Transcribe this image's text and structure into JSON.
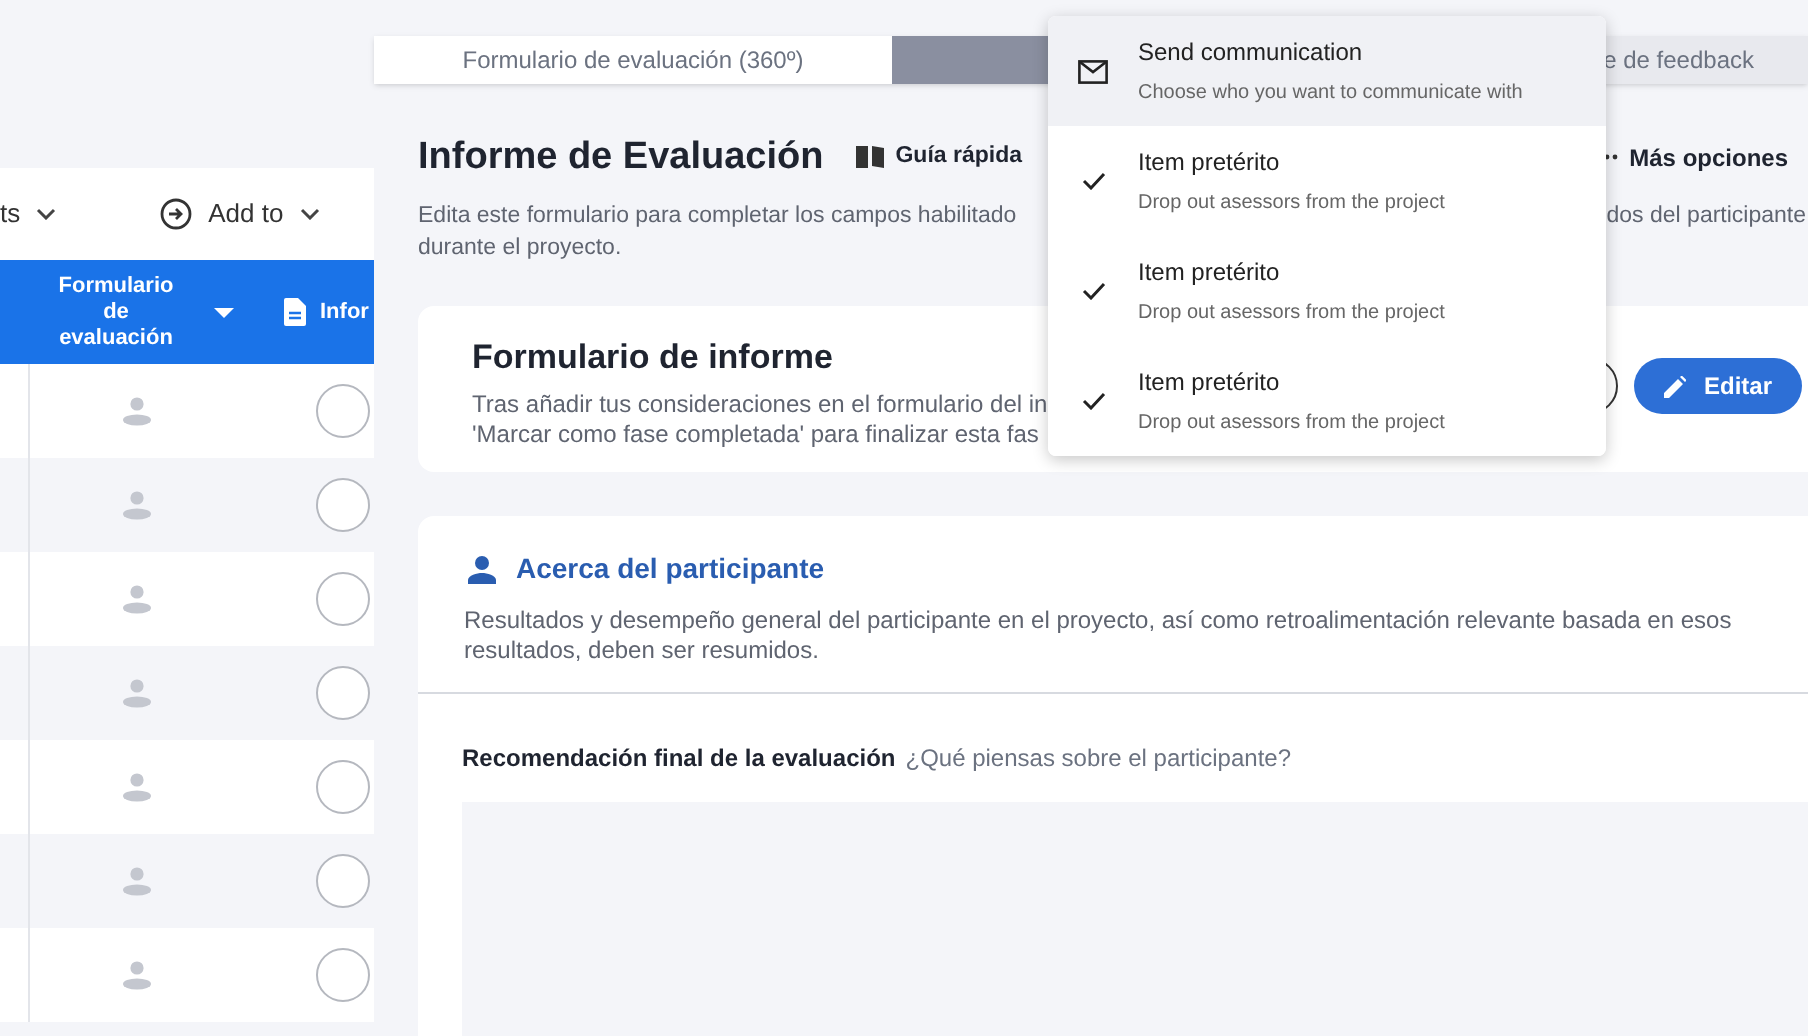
{
  "left_panel": {
    "toolbar": [
      {
        "label": "ts",
        "kind": "dropdown"
      },
      {
        "label": "Add to",
        "kind": "add"
      }
    ],
    "table": {
      "columns": [
        {
          "label": "Formulario de evaluación",
          "kind": "sort"
        },
        {
          "label": "Infor",
          "kind": "doc"
        }
      ],
      "rows": [
        {
          "checked": false
        },
        {
          "checked": false
        },
        {
          "checked": false
        },
        {
          "checked": false
        },
        {
          "checked": false
        },
        {
          "checked": false
        },
        {
          "checked": false
        }
      ]
    }
  },
  "tabs": [
    {
      "label": "Formulario de evaluación (360º)",
      "selected": false
    },
    {
      "selected": true
    },
    {
      "label": "e de feedback",
      "selected": false
    }
  ],
  "header": {
    "title": "Informe de Evaluación",
    "quick_guide": "Guía rápida",
    "more_options": "Más opciones",
    "description_left": "Edita este formulario para completar los campos habilitado",
    "description_right": "dos del participante",
    "description_line2": "durante el proyecto."
  },
  "form_card": {
    "title": "Formulario de informe",
    "text_line1": "Tras añadir tus consideraciones en el formulario del in",
    "text_line2": "'Marcar como fase completada' para finalizar esta fas",
    "edit_button": "Editar"
  },
  "section": {
    "title": "Acerca del participante",
    "description": "Resultados y desempeño general del participante en el proyecto, así como retroalimentación relevante basada en esos resultados, deben ser resumidos.",
    "field": {
      "label": "Recomendación final de la evaluación",
      "hint": "¿Qué piensas sobre el participante?"
    }
  },
  "menu": {
    "items": [
      {
        "kind": "mail",
        "title": "Send communication",
        "subtitle": "Choose who you want to communicate with",
        "selected": true
      },
      {
        "kind": "check",
        "title": "Item pretérito",
        "subtitle": "Drop out asessors from the project",
        "selected": false
      },
      {
        "kind": "check",
        "title": "Item pretérito",
        "subtitle": "Drop out asessors from the project",
        "selected": false
      },
      {
        "kind": "check",
        "title": "Item pretérito",
        "subtitle": "Drop out asessors from the project",
        "selected": false
      }
    ]
  }
}
